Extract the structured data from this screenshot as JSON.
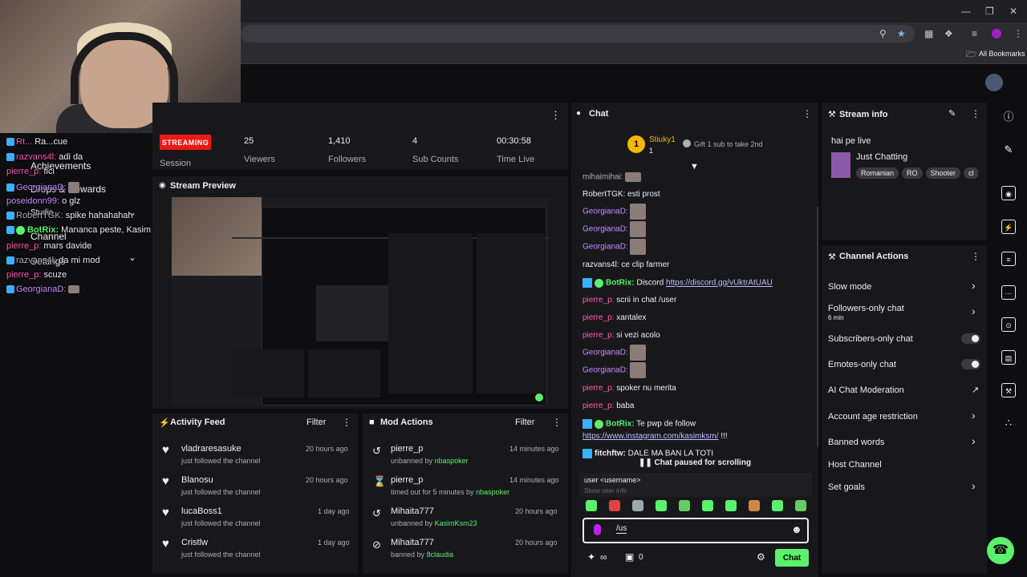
{
  "browser": {
    "bookmarks_label": "All Bookmarks"
  },
  "stats": {
    "streaming_badge": "STREAMING",
    "session_label": "Session",
    "viewers_value": "25",
    "viewers_label": "Viewers",
    "followers_value": "1,410",
    "followers_label": "Followers",
    "subs_value": "4",
    "subs_label": "Sub Counts",
    "time_value": "00:30:58",
    "time_label": "Time Live"
  },
  "preview": {
    "title": "Stream Preview"
  },
  "overlay": {
    "lines": [
      {
        "name": "Rt...",
        "text": "Ra...cue"
      },
      {
        "name": "razvans4l:",
        "text": "adi da"
      },
      {
        "name": "pierre_p:",
        "text": "fici"
      },
      {
        "name": "GeorgianaD:",
        "text": ""
      },
      {
        "name": "poseidonn99:",
        "text": "o glz"
      },
      {
        "name": "RobertTGK:",
        "text": "spike hahahahah"
      },
      {
        "name": "BotRix:",
        "text": "Mananca peste, Kasim te iubeste !!!"
      },
      {
        "name": "pierre_p:",
        "text": "mars davide"
      },
      {
        "name": "razvans4l:",
        "text": "da mi mod"
      },
      {
        "name": "pierre_p:",
        "text": "scuze"
      },
      {
        "name": "GeorgianaD:",
        "text": ""
      }
    ],
    "menu": [
      "Achievements",
      "Drops & Rewards",
      "Studio",
      "Channel",
      "Settings"
    ]
  },
  "activity_feed": {
    "title": "Activity Feed",
    "filter_label": "Filter",
    "items": [
      {
        "name": "vladraresasuke",
        "sub": "just followed the channel",
        "time": "20 hours ago"
      },
      {
        "name": "Blanosu",
        "sub": "just followed the channel",
        "time": "20 hours ago"
      },
      {
        "name": "lucaBoss1",
        "sub": "just followed the channel",
        "time": "1 day ago"
      },
      {
        "name": "Cristlw",
        "sub": "just followed the channel",
        "time": "1 day ago"
      }
    ]
  },
  "mod_actions": {
    "title": "Mod Actions",
    "filter_label": "Filter",
    "items": [
      {
        "name": "pierre_p",
        "action": "unbanned by",
        "by": "nbaspoker",
        "time": "14 minutes ago",
        "icon": "undo-icon"
      },
      {
        "name": "pierre_p",
        "action": "timed out for 5 minutes by",
        "by": "nbaspoker",
        "time": "14 minutes ago",
        "icon": "hourglass-icon"
      },
      {
        "name": "Mihaita777",
        "action": "unbanned by",
        "by": "KasimKsm23",
        "time": "20 hours ago",
        "icon": "undo-icon"
      },
      {
        "name": "Mihaita777",
        "action": "banned by",
        "by": "8claudia",
        "time": "20 hours ago",
        "icon": "ban-icon"
      }
    ]
  },
  "chat": {
    "title": "Chat",
    "top_user": "Stiuky1",
    "top_user_count": "1",
    "gift_text": "Gift 1 sub to take 2nd",
    "messages": [
      {
        "user": "mihaimihai:",
        "cls": "u-gray",
        "text": "",
        "emote": true
      },
      {
        "user": "RobertTGK:",
        "cls": "u-gray",
        "text": "esti prost"
      },
      {
        "user": "GeorgianaD:",
        "cls": "u-purple",
        "text": "",
        "emote": true
      },
      {
        "user": "GeorgianaD:",
        "cls": "u-purple",
        "text": "",
        "emote": true
      },
      {
        "user": "GeorgianaD:",
        "cls": "u-purple",
        "text": "",
        "emote": true
      },
      {
        "user": "razvans4l:",
        "cls": "u-gray",
        "text": "ce clip farmer"
      },
      {
        "user": "BotRix:",
        "cls": "u-green",
        "text": "Discord ",
        "link": "https://discord.gg/vUktrAtUAU",
        "bot": true
      },
      {
        "user": "pierre_p:",
        "cls": "u-pink",
        "text": "scrii in chat /user"
      },
      {
        "user": "pierre_p:",
        "cls": "u-pink",
        "text": "xantalex"
      },
      {
        "user": "pierre_p:",
        "cls": "u-pink",
        "text": "si vezi acolo"
      },
      {
        "user": "GeorgianaD:",
        "cls": "u-purple",
        "text": "",
        "emote": true
      },
      {
        "user": "GeorgianaD:",
        "cls": "u-purple",
        "text": "",
        "emote": true
      },
      {
        "user": "pierre_p:",
        "cls": "u-pink",
        "text": "spoker nu merita"
      },
      {
        "user": "pierre_p:",
        "cls": "u-pink",
        "text": "baba"
      },
      {
        "user": "BotRix:",
        "cls": "u-green",
        "text": "Te pwp de follow",
        "bot": true
      },
      {
        "user": "",
        "cls": "",
        "text": " !!!",
        "link": "https://www.instagram.com/kasimksm/"
      },
      {
        "user": "fitchftw:",
        "cls": "u-white",
        "text": "DALE MA BAN LA TOTI",
        "bot": true
      }
    ],
    "paused_text": "Chat paused for scrolling",
    "suggestion_cmd": "user <username>",
    "suggestion_desc": "Show user info",
    "input_value": "/us",
    "points": "0",
    "send_label": "Chat"
  },
  "stream_info": {
    "title": "Stream info",
    "stream_title": "hai pe live",
    "category": "Just Chatting",
    "tags": [
      "Romanian",
      "RO",
      "Shooter",
      "cl"
    ]
  },
  "channel_actions": {
    "title": "Channel Actions",
    "slow_mode": "Slow mode",
    "followers_only": "Followers-only chat",
    "followers_only_sub": "6 min",
    "subscribers_only": "Subscribers-only chat",
    "emotes_only": "Emotes-only chat",
    "ai_moderation": "AI Chat Moderation",
    "account_age": "Account age restriction",
    "banned_words": "Banned words",
    "host_channel": "Host Channel",
    "set_goals": "Set goals"
  },
  "colors": {
    "accent": "#5bf16d",
    "live": "#e91916",
    "panel": "#18181b",
    "background": "#0e0e10"
  }
}
